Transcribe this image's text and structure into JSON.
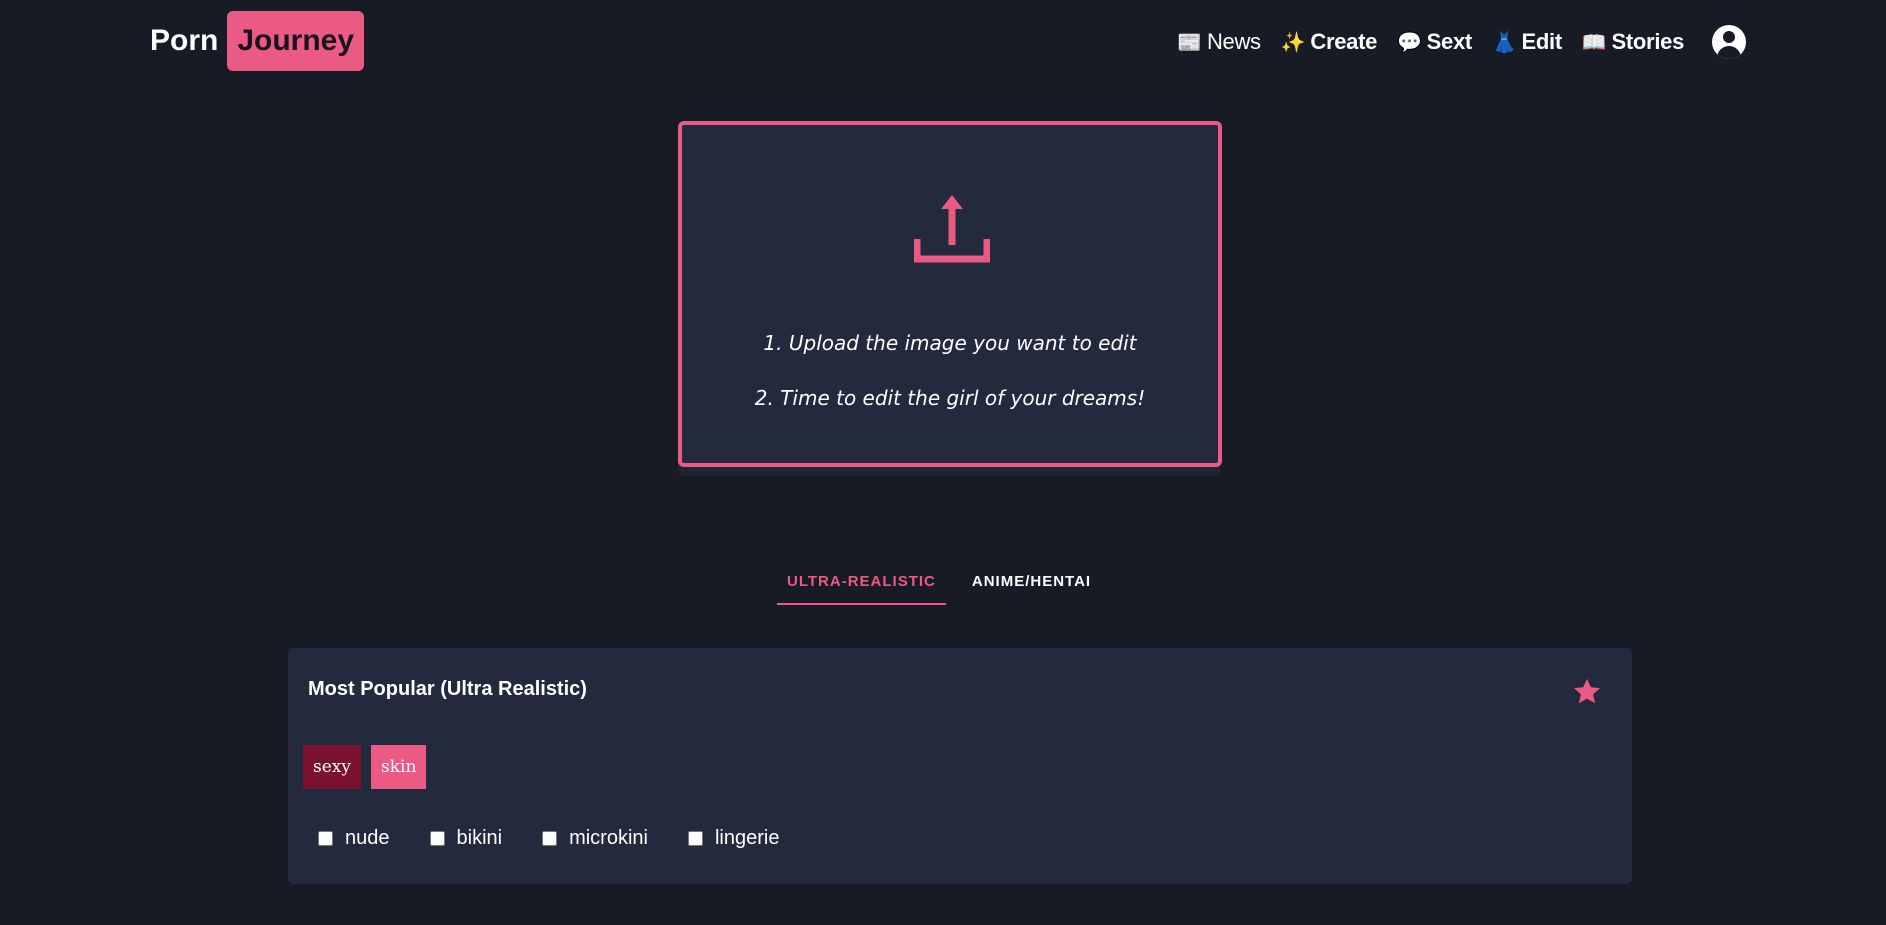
{
  "header": {
    "logo_part1": "Porn",
    "logo_part2": "Journey",
    "nav": [
      {
        "icon": "📰",
        "label": "News"
      },
      {
        "icon": "✨",
        "label": "Create"
      },
      {
        "icon": "💬",
        "label": "Sext"
      },
      {
        "icon": "👗",
        "label": "Edit"
      },
      {
        "icon": "📖",
        "label": "Stories"
      }
    ]
  },
  "upload": {
    "step1": "1. Upload the image you want to edit",
    "step2": "2. Time to edit the girl of your dreams!"
  },
  "tabs": [
    {
      "label": "ULTRA-REALISTIC",
      "active": true
    },
    {
      "label": "ANIME/HENTAI",
      "active": false
    }
  ],
  "panel": {
    "title": "Most Popular (Ultra Realistic)",
    "tags": [
      "sexy",
      "skin"
    ],
    "checkboxes": [
      "nude",
      "bikini",
      "microkini",
      "lingerie"
    ]
  },
  "colors": {
    "accent": "#eb5a82",
    "background": "#171b26",
    "panel": "#232a3d",
    "tag_dark": "#7a1230"
  }
}
